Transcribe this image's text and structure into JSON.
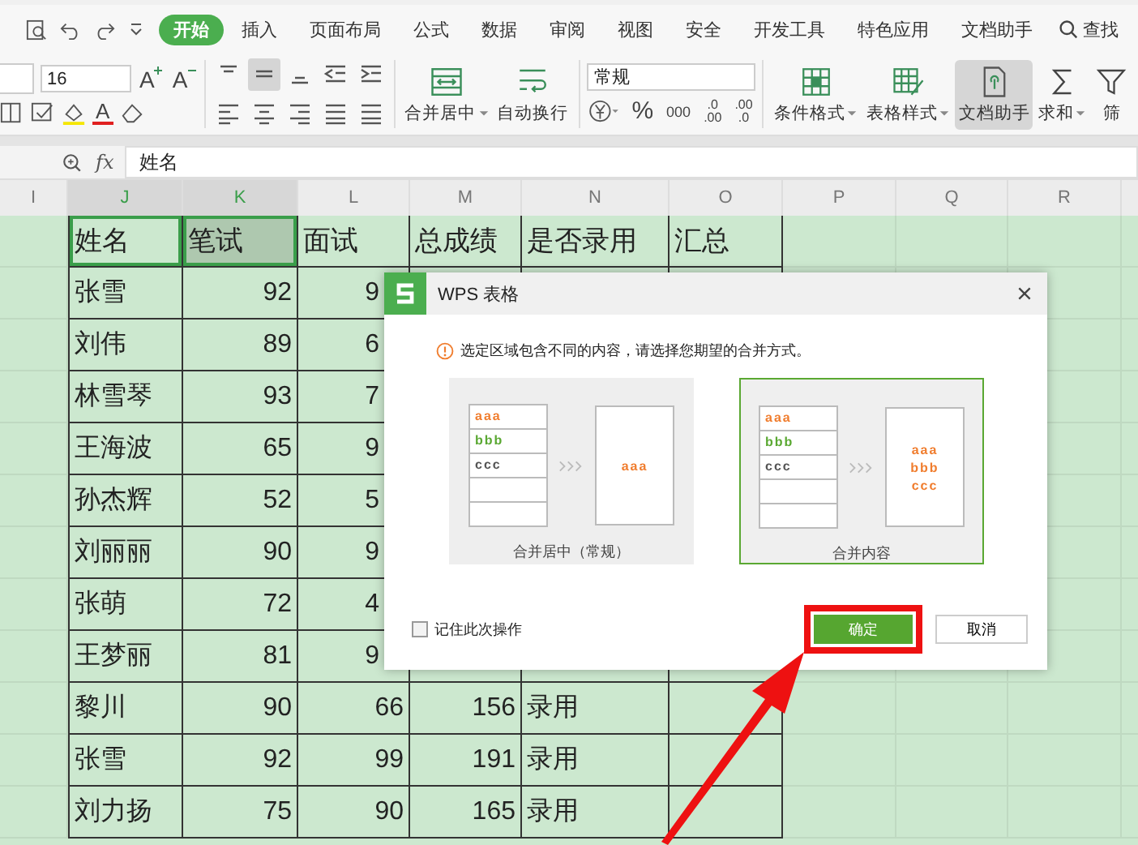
{
  "tabs": [
    {
      "label": "开始",
      "selected": true
    },
    {
      "label": "插入",
      "selected": false
    },
    {
      "label": "页面布局",
      "selected": false
    },
    {
      "label": "公式",
      "selected": false
    },
    {
      "label": "数据",
      "selected": false
    },
    {
      "label": "审阅",
      "selected": false
    },
    {
      "label": "视图",
      "selected": false
    },
    {
      "label": "安全",
      "selected": false
    },
    {
      "label": "开发工具",
      "selected": false
    },
    {
      "label": "特色应用",
      "selected": false
    },
    {
      "label": "文档助手",
      "selected": false
    }
  ],
  "search_label": "查找",
  "ribbon": {
    "font_size": "16",
    "font_buttons": [
      {
        "kind": "grow",
        "label": "A"
      },
      {
        "kind": "shrink",
        "label": "A"
      }
    ],
    "font_color": "A",
    "align_buttons": [
      {
        "kind": "top",
        "selected": false
      },
      {
        "kind": "middle",
        "selected": true
      },
      {
        "kind": "bottom",
        "selected": false
      },
      {
        "kind": "outdent",
        "selected": false
      },
      {
        "kind": "indent",
        "selected": false
      }
    ],
    "big_buttons": [
      {
        "kind": "merge",
        "label": "合并居中",
        "dropdown": true
      },
      {
        "kind": "wrap",
        "label": "自动换行",
        "dropdown": false
      }
    ],
    "number_format": "常规",
    "number_buttons": [
      {
        "kind": "percent",
        "label": "%"
      },
      {
        "kind": "thousands",
        "label": "000"
      },
      {
        "kind": "inc-decimal",
        "top": ".0",
        "bottom": ".00"
      },
      {
        "kind": "dec-decimal",
        "top": ".00",
        "bottom": ".0"
      }
    ],
    "tool_buttons": [
      {
        "kind": "conditional",
        "label": "条件格式",
        "dropdown": true,
        "selected": false
      },
      {
        "kind": "table-style",
        "label": "表格样式",
        "dropdown": true,
        "selected": false
      },
      {
        "kind": "doc-helper",
        "label": "文档助手",
        "dropdown": false,
        "selected": true
      },
      {
        "kind": "sum",
        "label": "求和",
        "dropdown": true,
        "selected": false
      },
      {
        "kind": "filter",
        "label": "筛",
        "dropdown": false,
        "selected": false
      }
    ]
  },
  "formula_bar": {
    "fx": "fx",
    "value": "姓名"
  },
  "columns": [
    {
      "label": "I",
      "selected": false
    },
    {
      "label": "J",
      "selected": true
    },
    {
      "label": "K",
      "selected": true
    },
    {
      "label": "L",
      "selected": false
    },
    {
      "label": "M",
      "selected": false
    },
    {
      "label": "N",
      "selected": false
    },
    {
      "label": "O",
      "selected": false
    },
    {
      "label": "P",
      "selected": false
    },
    {
      "label": "Q",
      "selected": false
    },
    {
      "label": "R",
      "selected": false
    }
  ],
  "table": {
    "header": [
      {
        "text": "姓名",
        "selected": true
      },
      {
        "text": "笔试",
        "selected": true
      },
      {
        "text": "面试",
        "selected": false
      },
      {
        "text": "总成绩",
        "selected": false
      },
      {
        "text": "是否录用",
        "selected": false
      },
      {
        "text": "汇总",
        "selected": false
      }
    ],
    "rows": [
      {
        "covered": true,
        "cells": [
          "张雪",
          "92",
          "9"
        ]
      },
      {
        "covered": true,
        "cells": [
          "刘伟",
          "89",
          "6"
        ]
      },
      {
        "covered": true,
        "cells": [
          "林雪琴",
          "93",
          "7"
        ]
      },
      {
        "covered": true,
        "cells": [
          "王海波",
          "65",
          "9"
        ]
      },
      {
        "covered": true,
        "cells": [
          "孙杰辉",
          "52",
          "5"
        ]
      },
      {
        "covered": true,
        "cells": [
          "刘丽丽",
          "90",
          "9"
        ]
      },
      {
        "covered": true,
        "cells": [
          "张萌",
          "72",
          "4"
        ]
      },
      {
        "covered": true,
        "cells": [
          "王梦丽",
          "81",
          "9"
        ]
      },
      {
        "covered": false,
        "cells": [
          "黎川",
          "90",
          "66",
          "156",
          "录用"
        ]
      },
      {
        "covered": false,
        "cells": [
          "张雪",
          "92",
          "99",
          "191",
          "录用"
        ]
      },
      {
        "covered": false,
        "cells": [
          "刘力扬",
          "75",
          "90",
          "165",
          "录用"
        ]
      }
    ]
  },
  "dialog": {
    "title": "WPS 表格",
    "message": "选定区域包含不同的内容，请选择您期望的合并方式。",
    "options": [
      {
        "label": "合并居中（常规）",
        "selected": false,
        "source": [
          {
            "text": "aaa",
            "color": "#f07d2e"
          },
          {
            "text": "bbb",
            "color": "#5aa832"
          },
          {
            "text": "ccc",
            "color": "#555555"
          }
        ],
        "result": [
          {
            "text": "aaa",
            "color": "#f07d2e"
          }
        ]
      },
      {
        "label": "合并内容",
        "selected": true,
        "source": [
          {
            "text": "aaa",
            "color": "#f07d2e"
          },
          {
            "text": "bbb",
            "color": "#5aa832"
          },
          {
            "text": "ccc",
            "color": "#555555"
          }
        ],
        "result": [
          {
            "text": "aaa",
            "color": "#f07d2e"
          },
          {
            "text": "bbb",
            "color": "#f07d2e"
          },
          {
            "text": "ccc",
            "color": "#f07d2e"
          }
        ]
      }
    ],
    "remember": {
      "label": "记住此次操作",
      "checked": false
    },
    "ok": "确定",
    "cancel": "取消"
  }
}
